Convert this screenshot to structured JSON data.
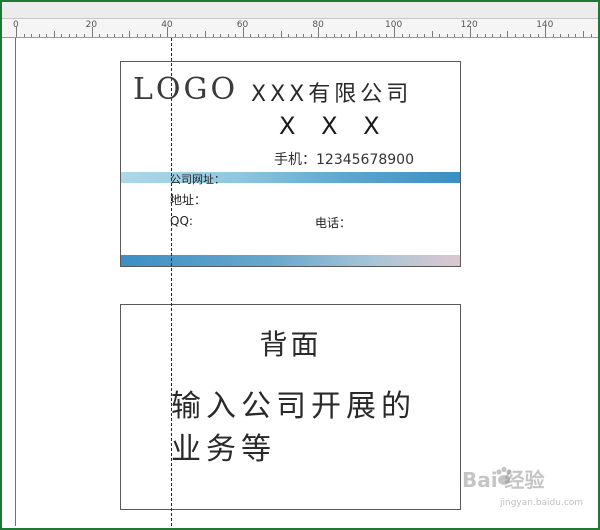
{
  "ruler": {
    "marks": [
      "0",
      "20",
      "40",
      "60",
      "80",
      "100",
      "120",
      "140"
    ]
  },
  "card_front": {
    "logo": "LOGO",
    "company": "XXX有限公司",
    "person_name": "X X X",
    "phone": "手机：12345678900",
    "website_label": "公司网址：",
    "address_label": "地址：",
    "qq_label": "QQ:",
    "tel_label": "电话："
  },
  "card_back": {
    "title": "背面",
    "body_line1": "输入公司开展的",
    "body_line2": "业务等"
  },
  "watermark": {
    "text": "Bai 经验",
    "subtext": "jingyan.baidu.com"
  },
  "colors": {
    "frame": "#1e7a32",
    "bar_start": "#aed8e8",
    "bar_end": "#3b8fc4",
    "bar_bottom_end": "#dcc8cf"
  }
}
